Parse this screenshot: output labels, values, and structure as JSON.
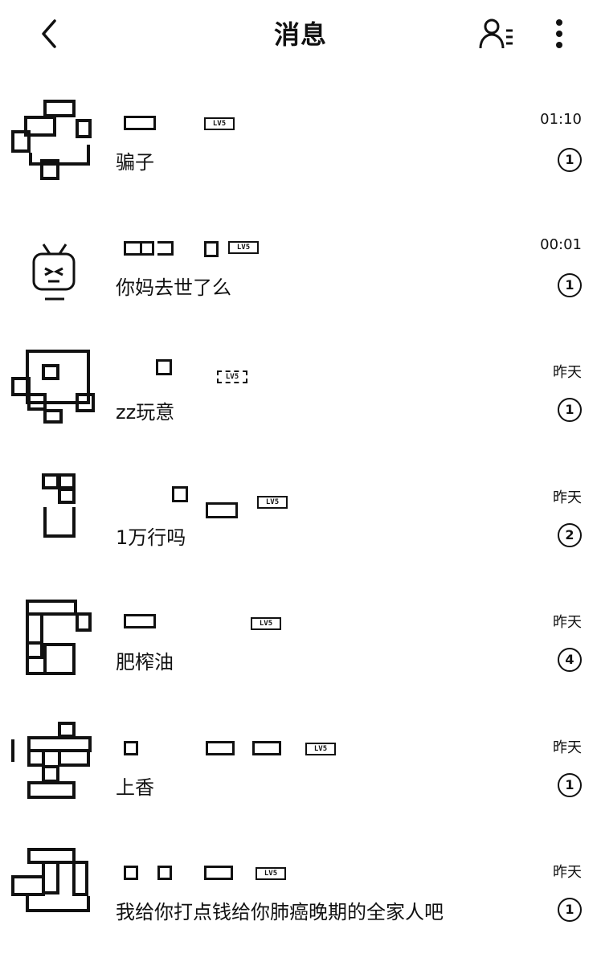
{
  "header": {
    "title": "消息",
    "back_icon": "chevron-left-icon",
    "contacts_icon": "contacts-list-icon",
    "more_icon": "more-vertical-icon"
  },
  "conversations": [
    {
      "message": "骗子",
      "time": "01:10",
      "unread": "1"
    },
    {
      "message": "你妈去世了么",
      "time": "00:01",
      "unread": "1"
    },
    {
      "message": "zz玩意",
      "time": "昨天",
      "unread": "1"
    },
    {
      "message": "1万行吗",
      "time": "昨天",
      "unread": "2"
    },
    {
      "message": "肥榨油",
      "time": "昨天",
      "unread": "4"
    },
    {
      "message": "上香",
      "time": "昨天",
      "unread": "1"
    },
    {
      "message": "我给你打点钱给你肺癌晚期的全家人吧",
      "time": "昨天",
      "unread": "1"
    }
  ]
}
